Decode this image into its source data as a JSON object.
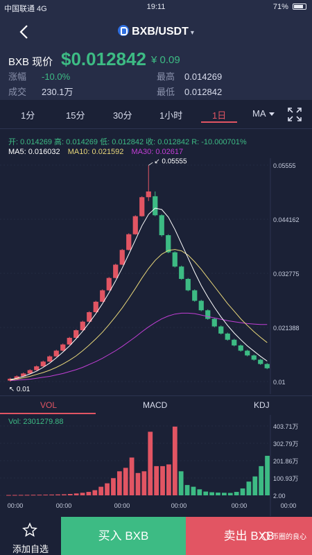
{
  "status_bar": {
    "carrier": "中国联通 4G",
    "time": "19:11",
    "battery": "71%"
  },
  "header": {
    "pair": "BXB/USDT",
    "price_label": "BXB 现价",
    "price": "$0.012842",
    "price_cny": "¥ 0.09",
    "change_label": "涨幅",
    "change_value": "-10.0%",
    "volume_label": "成交",
    "volume_value": "230.1万",
    "high_label": "最高",
    "high_value": "0.014269",
    "low_label": "最低",
    "low_value": "0.012842"
  },
  "intervals": {
    "items": [
      "1分",
      "15分",
      "30分",
      "1小时",
      "1日",
      "MA"
    ],
    "active": "1日"
  },
  "ohlc_line": "开: 0.014269  高: 0.014269  低: 0.012842  收: 0.012842  R: -10.000701%",
  "ma_legend": {
    "ma5": "MA5: 0.016032",
    "ma10": "MA10: 0.021592",
    "ma30": "MA30: 0.02617",
    "ma5_color": "#ffffff",
    "ma10_color": "#e8d77a",
    "ma30_color": "#c23fd6"
  },
  "colors": {
    "up": "#e25563",
    "down": "#3dbb84",
    "bg": "#1b2136",
    "grid": "#2c3450"
  },
  "sub_tabs": {
    "items": [
      "VOL",
      "MACD",
      "KDJ"
    ],
    "active": "VOL"
  },
  "vol_label": "Vol: 2301279.88",
  "bottom": {
    "fav_label": "添加自选",
    "buy_label": "买入 BXB",
    "sell_label": "卖出 BXB",
    "watermark": "币圈的良心"
  },
  "chart_data": [
    {
      "type": "candlestick",
      "y_axis_labels": [
        "0.05555",
        "0.044162",
        "0.032775",
        "0.021388",
        "0.01"
      ],
      "ylim": [
        0.01,
        0.05555
      ],
      "max_annotation": "0.05555",
      "min_annotation": "0.01",
      "candles": [
        {
          "o": 0.0102,
          "c": 0.0106,
          "h": 0.0108,
          "l": 0.01
        },
        {
          "o": 0.0106,
          "c": 0.0111,
          "h": 0.0113,
          "l": 0.0105
        },
        {
          "o": 0.0111,
          "c": 0.0117,
          "h": 0.0119,
          "l": 0.011
        },
        {
          "o": 0.0117,
          "c": 0.0124,
          "h": 0.0126,
          "l": 0.0116
        },
        {
          "o": 0.0124,
          "c": 0.0132,
          "h": 0.0134,
          "l": 0.0123
        },
        {
          "o": 0.0132,
          "c": 0.0142,
          "h": 0.0144,
          "l": 0.0131
        },
        {
          "o": 0.0142,
          "c": 0.0153,
          "h": 0.0155,
          "l": 0.0141
        },
        {
          "o": 0.0153,
          "c": 0.0165,
          "h": 0.0167,
          "l": 0.0152
        },
        {
          "o": 0.0165,
          "c": 0.0178,
          "h": 0.018,
          "l": 0.0164
        },
        {
          "o": 0.0178,
          "c": 0.0192,
          "h": 0.0194,
          "l": 0.0177
        },
        {
          "o": 0.0192,
          "c": 0.0208,
          "h": 0.021,
          "l": 0.0191
        },
        {
          "o": 0.0208,
          "c": 0.0226,
          "h": 0.0228,
          "l": 0.0207
        },
        {
          "o": 0.0226,
          "c": 0.0246,
          "h": 0.0248,
          "l": 0.0225
        },
        {
          "o": 0.0246,
          "c": 0.0268,
          "h": 0.027,
          "l": 0.0245
        },
        {
          "o": 0.0268,
          "c": 0.0292,
          "h": 0.0294,
          "l": 0.0267
        },
        {
          "o": 0.0292,
          "c": 0.0318,
          "h": 0.032,
          "l": 0.0291
        },
        {
          "o": 0.0318,
          "c": 0.0346,
          "h": 0.0348,
          "l": 0.0317
        },
        {
          "o": 0.0346,
          "c": 0.0377,
          "h": 0.0379,
          "l": 0.0345
        },
        {
          "o": 0.0377,
          "c": 0.041,
          "h": 0.0412,
          "l": 0.0376
        },
        {
          "o": 0.041,
          "c": 0.0448,
          "h": 0.045,
          "l": 0.0409
        },
        {
          "o": 0.0448,
          "c": 0.0488,
          "h": 0.049,
          "l": 0.0447
        },
        {
          "o": 0.0488,
          "c": 0.05,
          "h": 0.0555,
          "l": 0.048
        },
        {
          "o": 0.049,
          "c": 0.045,
          "h": 0.05,
          "l": 0.0448
        },
        {
          "o": 0.045,
          "c": 0.0408,
          "h": 0.0452,
          "l": 0.0405
        },
        {
          "o": 0.0408,
          "c": 0.0372,
          "h": 0.041,
          "l": 0.037
        },
        {
          "o": 0.0372,
          "c": 0.0342,
          "h": 0.0374,
          "l": 0.034
        },
        {
          "o": 0.0342,
          "c": 0.0316,
          "h": 0.0344,
          "l": 0.0314
        },
        {
          "o": 0.0316,
          "c": 0.0292,
          "h": 0.0318,
          "l": 0.029
        },
        {
          "o": 0.0292,
          "c": 0.027,
          "h": 0.0294,
          "l": 0.0268
        },
        {
          "o": 0.027,
          "c": 0.025,
          "h": 0.0272,
          "l": 0.0248
        },
        {
          "o": 0.025,
          "c": 0.0232,
          "h": 0.0252,
          "l": 0.023
        },
        {
          "o": 0.0232,
          "c": 0.0216,
          "h": 0.0234,
          "l": 0.0214
        },
        {
          "o": 0.0216,
          "c": 0.0201,
          "h": 0.0218,
          "l": 0.0199
        },
        {
          "o": 0.0201,
          "c": 0.0188,
          "h": 0.0203,
          "l": 0.0186
        },
        {
          "o": 0.0188,
          "c": 0.0176,
          "h": 0.019,
          "l": 0.0174
        },
        {
          "o": 0.0176,
          "c": 0.0165,
          "h": 0.0178,
          "l": 0.0163
        },
        {
          "o": 0.0165,
          "c": 0.0155,
          "h": 0.0167,
          "l": 0.0153
        },
        {
          "o": 0.0155,
          "c": 0.0146,
          "h": 0.0157,
          "l": 0.0144
        },
        {
          "o": 0.0146,
          "c": 0.0137,
          "h": 0.0148,
          "l": 0.0135
        },
        {
          "o": 0.0137,
          "c": 0.0128,
          "h": 0.0139,
          "l": 0.0126
        }
      ],
      "ma5": [
        0.0104,
        0.0107,
        0.0111,
        0.0116,
        0.0122,
        0.013,
        0.0139,
        0.015,
        0.0162,
        0.0175,
        0.019,
        0.0206,
        0.0224,
        0.0243,
        0.0264,
        0.0287,
        0.0312,
        0.0339,
        0.0368,
        0.0398,
        0.0428,
        0.0452,
        0.0465,
        0.0462,
        0.0446,
        0.042,
        0.039,
        0.036,
        0.033,
        0.0302,
        0.0278,
        0.0256,
        0.0236,
        0.0218,
        0.0202,
        0.0188,
        0.0175,
        0.0164,
        0.0153,
        0.0143
      ],
      "ma10": [
        0.0103,
        0.0105,
        0.0108,
        0.0111,
        0.0115,
        0.0119,
        0.0124,
        0.013,
        0.0137,
        0.0145,
        0.0154,
        0.0165,
        0.0177,
        0.019,
        0.0204,
        0.022,
        0.0237,
        0.0255,
        0.0275,
        0.0296,
        0.0318,
        0.0338,
        0.0355,
        0.0368,
        0.0376,
        0.0378,
        0.0375,
        0.0366,
        0.0352,
        0.0336,
        0.0318,
        0.03,
        0.0282,
        0.0264,
        0.0248,
        0.0232,
        0.0218,
        0.0205,
        0.0193,
        0.0182
      ],
      "ma30": [
        0.0102,
        0.0103,
        0.0104,
        0.0105,
        0.0107,
        0.0109,
        0.0111,
        0.0114,
        0.0117,
        0.0121,
        0.0125,
        0.013,
        0.0136,
        0.0142,
        0.0149,
        0.0157,
        0.0165,
        0.0174,
        0.0184,
        0.0194,
        0.0205,
        0.0215,
        0.0224,
        0.0232,
        0.0238,
        0.0242,
        0.0244,
        0.0244,
        0.0243,
        0.024,
        0.0237,
        0.0234,
        0.0231,
        0.0228,
        0.0226,
        0.0224,
        0.0222,
        0.0221,
        0.022,
        0.022
      ]
    },
    {
      "type": "bar",
      "y_axis_labels": [
        "403.71万",
        "302.79万",
        "201.86万",
        "100.93万",
        "2.00"
      ],
      "ylim": [
        2,
        4037100
      ],
      "x_tick_labels": [
        "00:00",
        "00:00",
        "00:00",
        "00:00",
        "00:00",
        "00:00"
      ],
      "values": [
        20000,
        22000,
        25000,
        28000,
        32000,
        36000,
        40000,
        45000,
        52000,
        60000,
        80000,
        110000,
        150000,
        200000,
        300000,
        500000,
        700000,
        1000000,
        1400000,
        1600000,
        2200000,
        1300000,
        1400000,
        3700000,
        1700000,
        1700000,
        1800000,
        4000000,
        1400000,
        600000,
        500000,
        350000,
        220000,
        180000,
        160000,
        150000,
        140000,
        200000,
        400000,
        800000,
        1100000,
        1700000,
        2300000
      ],
      "up": [
        true,
        true,
        true,
        true,
        true,
        true,
        true,
        true,
        true,
        true,
        true,
        true,
        true,
        true,
        true,
        true,
        true,
        true,
        true,
        true,
        true,
        true,
        true,
        true,
        true,
        true,
        true,
        true,
        false,
        false,
        false,
        false,
        false,
        false,
        false,
        false,
        false,
        false,
        false,
        false,
        false,
        false,
        false
      ]
    }
  ]
}
